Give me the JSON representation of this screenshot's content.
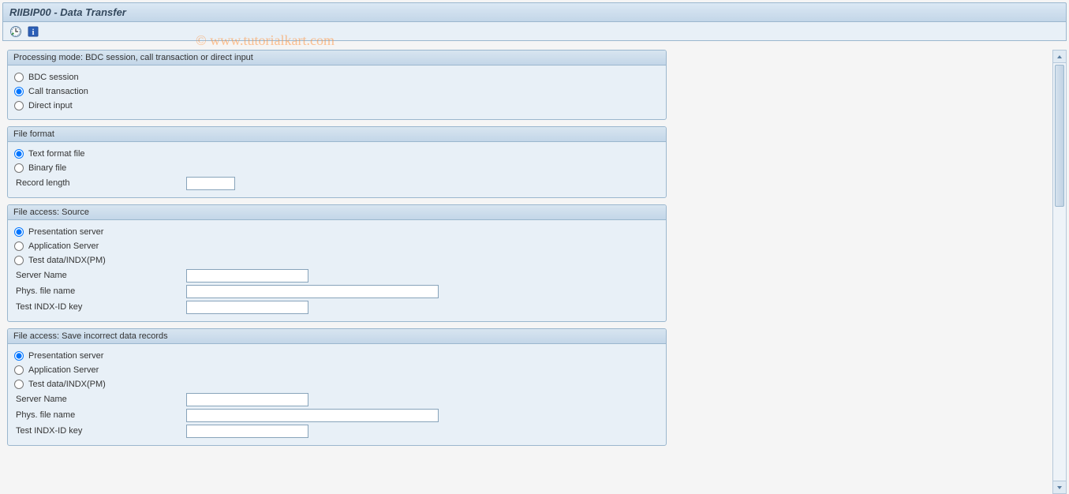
{
  "header": {
    "title": "RIIBIP00 - Data Transfer"
  },
  "watermark": "© www.tutorialkart.com",
  "toolbar": {
    "execute_icon": "execute-icon",
    "info_icon": "info-icon"
  },
  "panels": {
    "processing_mode": {
      "title": "Processing mode: BDC session, call transaction or direct input",
      "options": {
        "bdc": "BDC session",
        "call": "Call transaction",
        "direct": "Direct input"
      },
      "selected": "call"
    },
    "file_format": {
      "title": "File format",
      "options": {
        "text": "Text format file",
        "binary": "Binary file"
      },
      "selected": "text",
      "record_length_label": "Record length",
      "record_length_value": ""
    },
    "source": {
      "title": "File access: Source",
      "options": {
        "presentation": "Presentation server",
        "application": "Application Server",
        "testdata": "Test data/INDX(PM)"
      },
      "selected": "presentation",
      "server_name_label": "Server Name",
      "server_name_value": "",
      "phys_file_label": "Phys. file name",
      "phys_file_value": "",
      "indx_label": "Test INDX-ID key",
      "indx_value": ""
    },
    "save_incorrect": {
      "title": "File access: Save incorrect data records",
      "options": {
        "presentation": "Presentation server",
        "application": "Application Server",
        "testdata": "Test data/INDX(PM)"
      },
      "selected": "presentation",
      "server_name_label": "Server Name",
      "server_name_value": "",
      "phys_file_label": "Phys. file name",
      "phys_file_value": "",
      "indx_label": "Test INDX-ID key",
      "indx_value": ""
    }
  }
}
